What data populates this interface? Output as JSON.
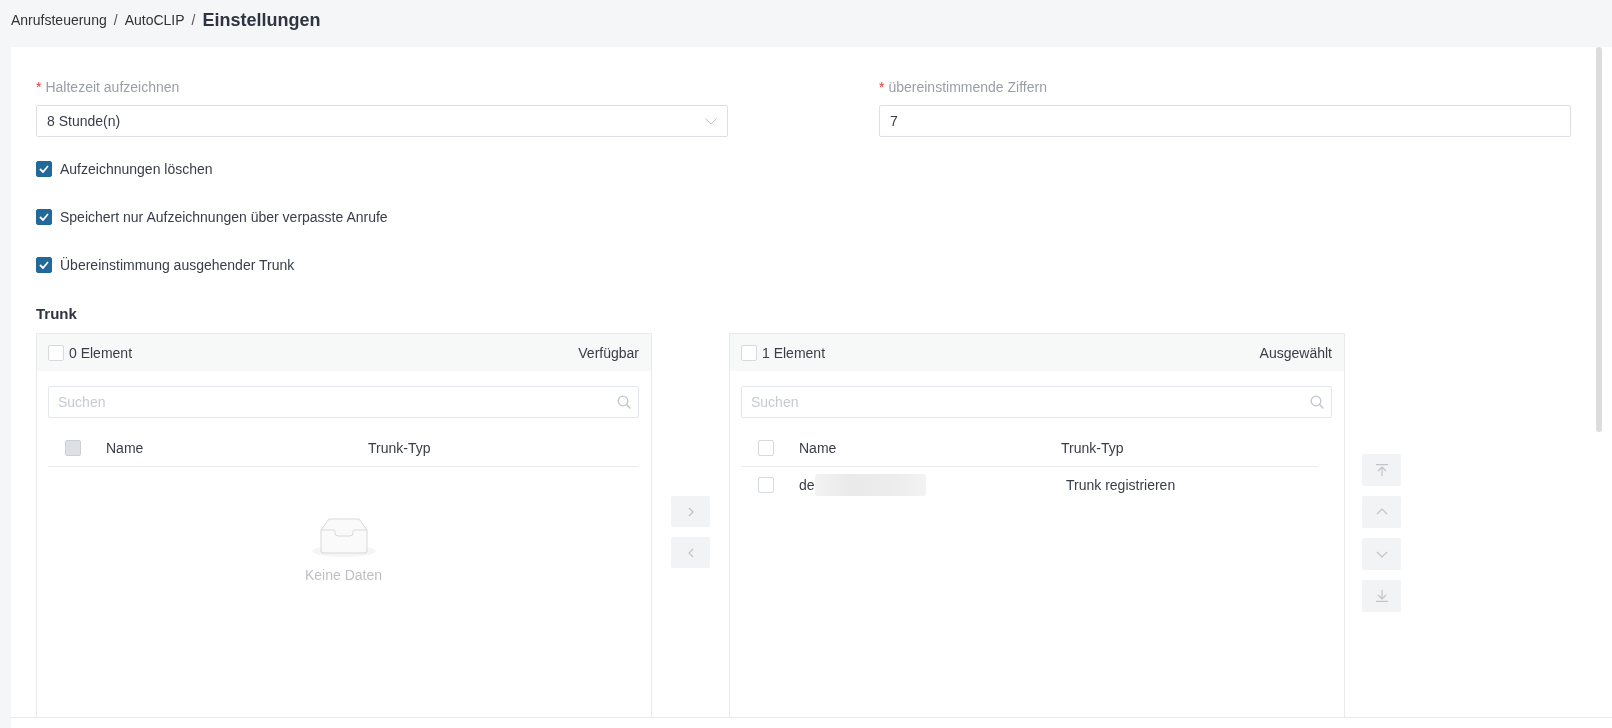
{
  "breadcrumb": [
    {
      "label": "Anrufsteuerung",
      "separator": "/",
      "current": false
    },
    {
      "label": "AutoCLIP",
      "separator": "/",
      "current": false
    },
    {
      "label": "Einstellungen",
      "current": true
    }
  ],
  "fields": [
    {
      "kind": "select",
      "required_mark": "*",
      "label": "Haltezeit aufzeichnen",
      "value": "8 Stunde(n)"
    },
    {
      "kind": "input",
      "required_mark": "*",
      "label": "übereinstimmende Ziffern",
      "value": "7"
    }
  ],
  "options": [
    {
      "label": "Aufzeichnungen löschen",
      "checked": true
    },
    {
      "label": "Speichert nur Aufzeichnungen über verpasste Anrufe",
      "checked": true
    },
    {
      "label": "Übereinstimmung ausgehender Trunk",
      "checked": true
    }
  ],
  "trunk": {
    "title": "Trunk",
    "panels": [
      {
        "checked": false,
        "count": "0 Element",
        "title": "Verfügbar",
        "search": {
          "placeholder": "Suchen"
        },
        "header_checkbox": {
          "checked": false,
          "disabled": true
        },
        "columns": [
          "Name",
          "Trunk-Typ"
        ],
        "empty_text": "Keine Daten"
      },
      {
        "checked": false,
        "count": "1 Element",
        "title": "Ausgewählt",
        "search": {
          "placeholder": "Suchen"
        },
        "header_checkbox": {
          "checked": false,
          "disabled": false
        },
        "columns": [
          "Name",
          "Trunk-Typ"
        ],
        "rows": [
          {
            "checked": false,
            "name": "de",
            "redacted": true,
            "trunk_type": "Trunk registrieren"
          }
        ]
      }
    ],
    "move_buttons": [
      {
        "kind": "right",
        "disabled": true
      },
      {
        "kind": "left",
        "disabled": true
      }
    ],
    "sort_buttons": [
      {
        "kind": "top",
        "disabled": true
      },
      {
        "kind": "up",
        "disabled": true
      },
      {
        "kind": "down",
        "disabled": true
      },
      {
        "kind": "bottom",
        "disabled": true
      }
    ]
  }
}
